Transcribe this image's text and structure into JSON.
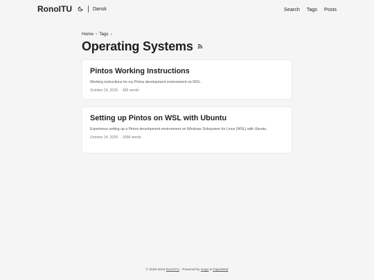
{
  "header": {
    "logo": "RonoITU",
    "language": "Dansk",
    "nav": [
      {
        "label": "Search"
      },
      {
        "label": "Tags"
      },
      {
        "label": "Posts"
      }
    ]
  },
  "breadcrumb": {
    "home": "Home",
    "tags": "Tags",
    "separator": "›"
  },
  "page": {
    "title": "Operating Systems"
  },
  "posts": [
    {
      "title": "Pintos Working Instructions",
      "summary": "Working instructions for my Pintos development environment on WSL.",
      "date": "October 16, 2025",
      "separator": "·",
      "words": "382 words"
    },
    {
      "title": "Setting up Pintos on WSL with Ubuntu",
      "summary": "Experience setting up a Pintos development environment on Windows Subsystem for Linux (WSL) with Ubuntu.",
      "date": "October 14, 2025",
      "separator": "·",
      "words": "1006 words"
    }
  ],
  "footer": {
    "copyright": "© 2025-2026",
    "site_link": "RonoITU",
    "separator": "·",
    "powered_by": "Powered by",
    "hugo": "Hugo",
    "amp": "&",
    "papermod": "PaperMod"
  },
  "colors": {
    "background": "#f5f5f5",
    "card": "#ffffff",
    "text": "#1e1e1e",
    "secondary": "#555555"
  },
  "icons": {
    "theme_toggle": "moon-icon",
    "feed": "rss-icon"
  }
}
